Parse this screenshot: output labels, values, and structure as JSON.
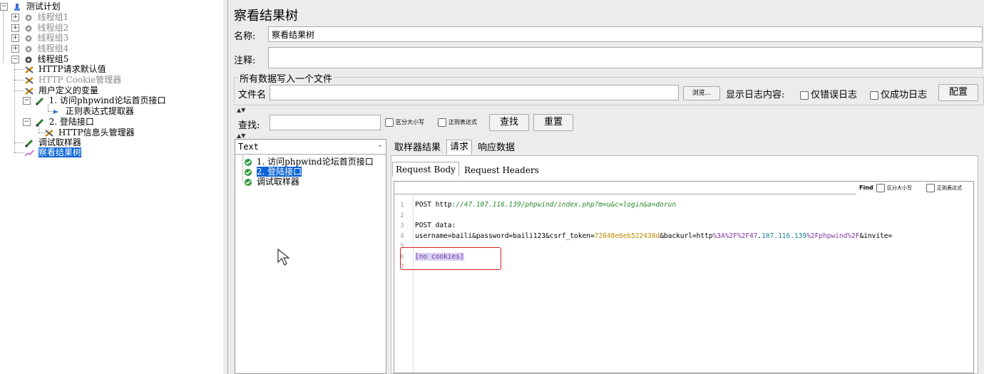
{
  "tree": {
    "root": "测试计划",
    "items": [
      {
        "label": "线程组1"
      },
      {
        "label": "线程组2"
      },
      {
        "label": "线程组3"
      },
      {
        "label": "线程组4"
      },
      {
        "label": "线程组5"
      },
      {
        "label": "HTTP请求默认值"
      },
      {
        "label": "HTTP Cookie管理器"
      },
      {
        "label": "用户定义的变量"
      },
      {
        "label": "1. 访问phpwind论坛首页接口"
      },
      {
        "label": "正则表达式提取器"
      },
      {
        "label": "2. 登陆接口"
      },
      {
        "label": "HTTP信息头管理器"
      },
      {
        "label": "调试取样器"
      },
      {
        "label": "察看结果树"
      }
    ]
  },
  "panel": {
    "title": "察看结果树",
    "name_label": "名称:",
    "name_value": "察看结果树",
    "comment_label": "注释:",
    "comment_value": "",
    "file_group_title": "所有数据写入一个文件",
    "filename_label": "文件名",
    "filename_value": "",
    "browse_label": "浏览...",
    "log_label": "显示日志内容:",
    "errors_only": "仅错误日志",
    "success_only": "仅成功日志",
    "config_label": "配置"
  },
  "search": {
    "label": "查找:",
    "value": "",
    "case_sensitive": "区分大小写",
    "regex": "正则表达式",
    "find_button": "查找",
    "reset_button": "重置"
  },
  "results": {
    "renderer": "Text",
    "samples": [
      {
        "label": "1. 访问phpwind论坛首页接口"
      },
      {
        "label": "2. 登陆接口"
      },
      {
        "label": "调试取样器"
      }
    ],
    "tabs": [
      "取样器结果",
      "请求",
      "响应数据"
    ],
    "subtabs": [
      "Request Body",
      "Request Headers"
    ],
    "find_label": "Find",
    "find_case": "区分大小写",
    "find_regex": "正则表达式"
  },
  "code": {
    "line_numbers": [
      "1",
      "2",
      "3",
      "4",
      "5",
      "6",
      "7"
    ],
    "line1_prefix": "POST http",
    "line1_url": "://47.107.116.139/phpwind/index.php?m=u&c=login&a=dorun",
    "line3": "POST data:",
    "line4_a": "username=baili&password=baili123&csrf_token=",
    "line4_token": "72848e6eb522430d",
    "line4_b": "&backurl=http",
    "line4_enc1": "%3A%2F%2F47",
    "line4_c": ".",
    "line4_num": "107.116.139",
    "line4_enc2": "%2Fphpwind%2F",
    "line4_d": "&invite=",
    "line6": "[no cookies]"
  }
}
